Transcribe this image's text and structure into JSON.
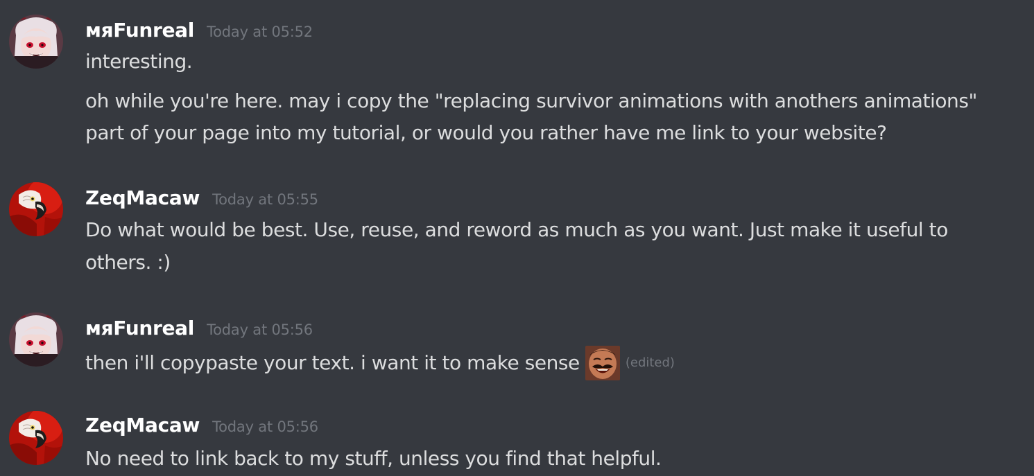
{
  "messages": [
    {
      "author": "мяFunreal",
      "timestamp": "Today at 05:52",
      "avatar_icon": "demon-girl-avatar-icon",
      "lines": [
        "interesting.",
        "oh while you're here. may i copy the \"replacing survivor animations with anothers animations\"",
        "part of your page into my tutorial, or would you rather have me link to your website?"
      ]
    },
    {
      "author": "ZeqMacaw",
      "timestamp": "Today at 05:55",
      "avatar_icon": "red-macaw-avatar-icon",
      "lines": [
        "Do what would be best. Use, reuse, and reword as much as you want. Just make it useful to",
        "others. :)"
      ]
    },
    {
      "author": "мяFunreal",
      "timestamp": "Today at 05:56",
      "avatar_icon": "demon-girl-avatar-icon",
      "lines": [
        "then i'll copypaste your text. i want it to make sense"
      ],
      "emoji_icon": "laughing-mustache-man-emoji-icon",
      "edited_label": "(edited)"
    },
    {
      "author": "ZeqMacaw",
      "timestamp": "Today at 05:56",
      "avatar_icon": "red-macaw-avatar-icon",
      "lines": [
        "No need to link back to my stuff, unless you find that helpful."
      ]
    }
  ],
  "colors": {
    "background": "#36393f",
    "username": "#ffffff",
    "message_text": "#dcddde",
    "muted": "#72767d"
  }
}
